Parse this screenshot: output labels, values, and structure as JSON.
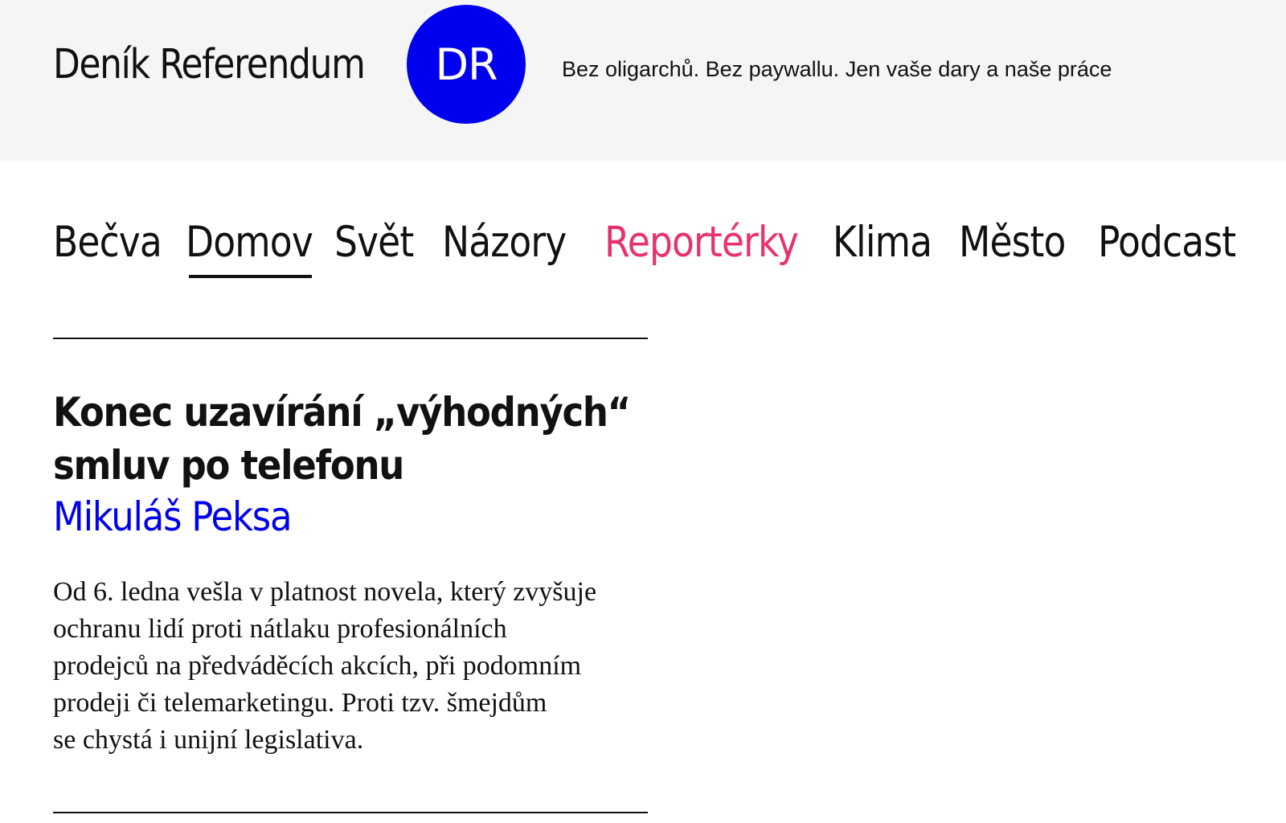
{
  "header": {
    "brand_name": "Deník Referendum",
    "logo_text": "DR",
    "tagline": "Bez oligarchů. Bez paywallu. Jen vaše dary a naše práce"
  },
  "nav": {
    "items": [
      {
        "label": "Bečva"
      },
      {
        "label": "Domov"
      },
      {
        "label": "Svět"
      },
      {
        "label": "Názory"
      },
      {
        "label": "Reportérky"
      },
      {
        "label": "Klima"
      },
      {
        "label": "Město"
      },
      {
        "label": "Podcast"
      }
    ],
    "active_item": "Domov"
  },
  "article": {
    "title_lines": [
      "Konec uzavírání „výhodných“",
      "smluv po telefonu"
    ],
    "author": "Mikuláš Peksa",
    "perex_lines": [
      "Od 6. ledna vešla v platnost novela, který zvyšuje",
      "ochranu lidí proti nátlaku profesionálních",
      "prodejců na předváděcích akcích, při podomním",
      "prodeji či telemarketingu. Proti tzv. šmejdům",
      "se chystá i unijní legislativa."
    ]
  },
  "colors": {
    "header_background": "#f5f5f5",
    "logo_blue": "#0000ee",
    "accent_pink": "#e8326c",
    "text": "#111111"
  }
}
